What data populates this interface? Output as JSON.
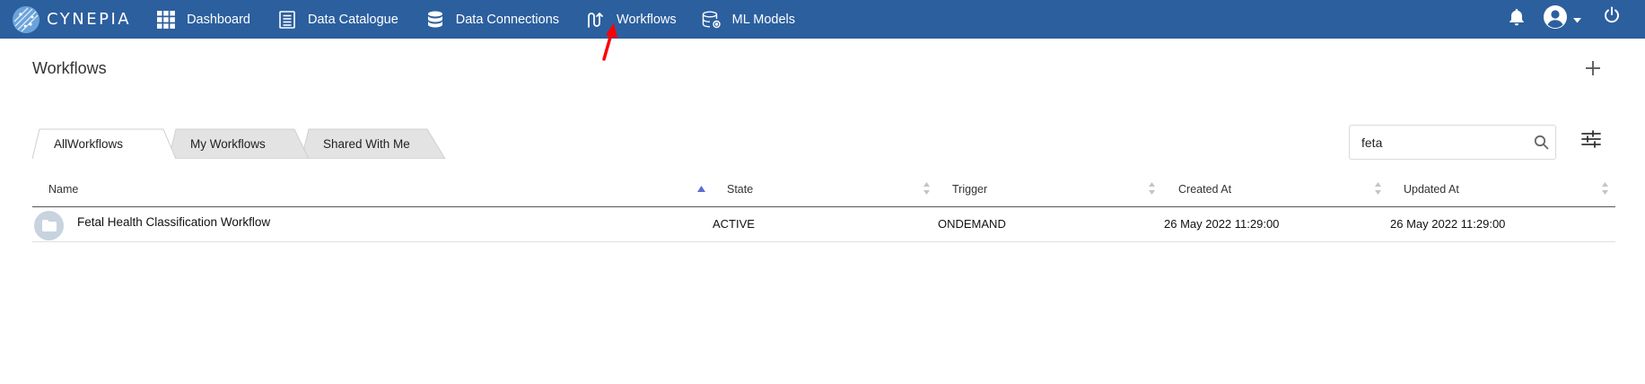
{
  "brand": {
    "name": "CYNEPIA"
  },
  "nav": {
    "items": [
      {
        "label": "Dashboard",
        "icon": "grid-icon"
      },
      {
        "label": "Data Catalogue",
        "icon": "document-list-icon"
      },
      {
        "label": "Data Connections",
        "icon": "database-icon"
      },
      {
        "label": "Workflows",
        "icon": "workflow-icon"
      },
      {
        "label": "ML Models",
        "icon": "ml-database-icon"
      }
    ]
  },
  "topbar_right": {
    "icons": [
      "bell-icon",
      "user-avatar-icon",
      "caret-down-icon",
      "power-icon"
    ]
  },
  "page": {
    "title": "Workflows",
    "add_icon": "plus-icon"
  },
  "tabs": [
    {
      "label": "AllWorkflows",
      "active": true
    },
    {
      "label": "My Workflows",
      "active": false
    },
    {
      "label": "Shared With Me",
      "active": false
    }
  ],
  "search": {
    "value": "feta",
    "placeholder": "",
    "icon": "search-icon"
  },
  "filter": {
    "icon": "sliders-icon"
  },
  "table": {
    "columns": [
      "Name",
      "State",
      "Trigger",
      "Created At",
      "Updated At"
    ],
    "sorted_column": "Name",
    "sort_direction": "asc",
    "rows": [
      {
        "name": "Fetal Health Classification Workflow",
        "state": "ACTIVE",
        "trigger": "ONDEMAND",
        "created_at": "26 May 2022 11:29:00",
        "updated_at": "26 May 2022 11:29:00",
        "icon": "folder-icon"
      }
    ]
  },
  "annotation": {
    "icon": "red-arrow-icon",
    "color": "#ff0000"
  },
  "colors": {
    "topbar": "#2c5f9e",
    "sort_active": "#5b6cd1",
    "tab_inactive": "#e0e0e0"
  }
}
